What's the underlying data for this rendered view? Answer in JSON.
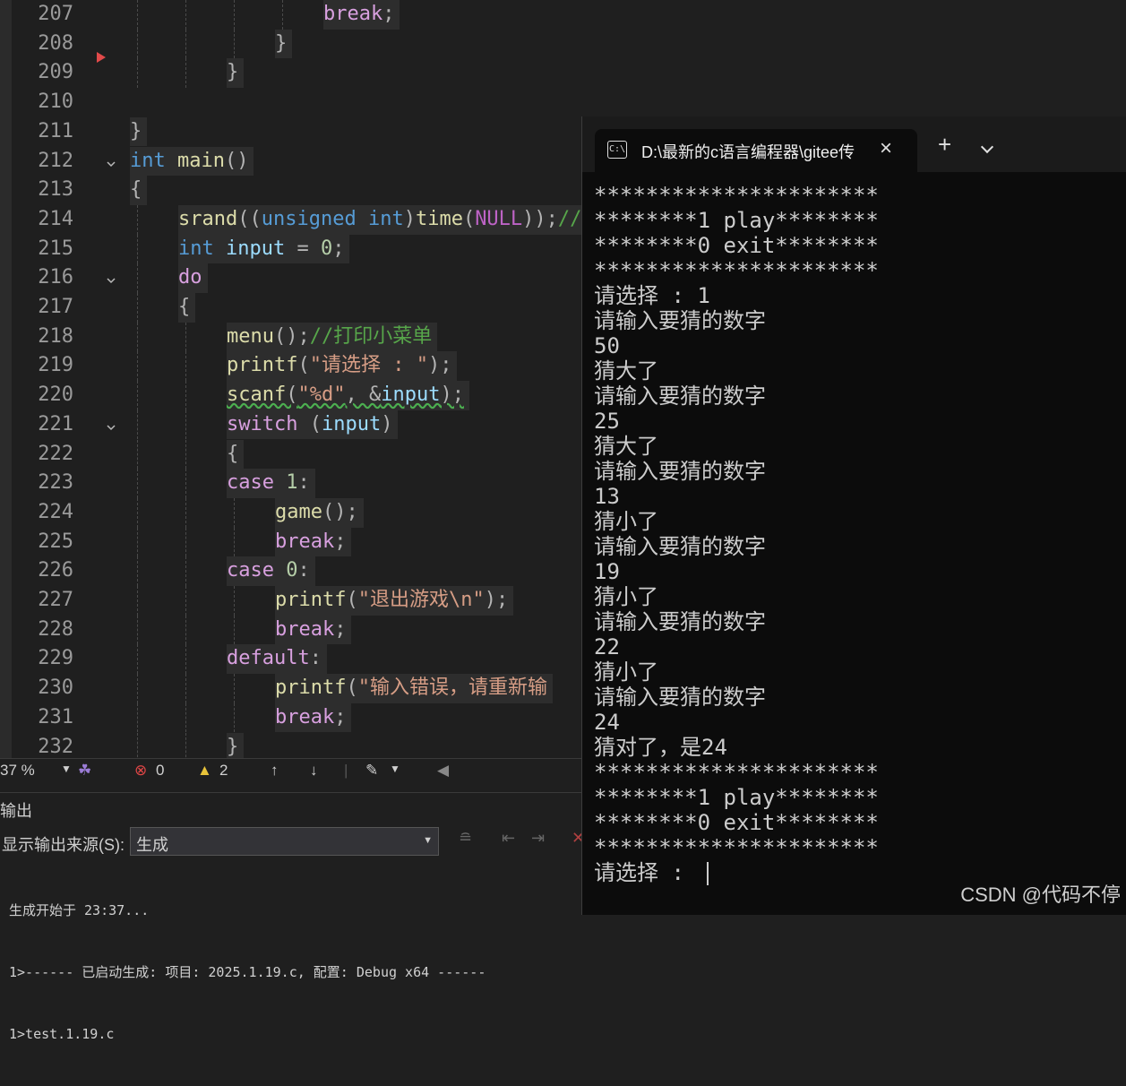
{
  "editor": {
    "lines": [
      {
        "n": "207",
        "indent": 4,
        "toks": [
          [
            "ctl",
            "break"
          ],
          [
            "pun",
            ";"
          ]
        ]
      },
      {
        "n": "208",
        "indent": 3,
        "toks": [
          [
            "pun",
            "}"
          ]
        ]
      },
      {
        "n": "209",
        "indent": 2,
        "toks": [
          [
            "pun",
            "}"
          ]
        ]
      },
      {
        "n": "210",
        "indent": 0,
        "toks": []
      },
      {
        "n": "211",
        "indent": 0,
        "toks": [
          [
            "pun",
            "}"
          ]
        ]
      },
      {
        "n": "212",
        "indent": 0,
        "fold": true,
        "toks": [
          [
            "kw",
            "int"
          ],
          [
            "pun",
            " "
          ],
          [
            "fn",
            "main"
          ],
          [
            "pun",
            "()"
          ]
        ]
      },
      {
        "n": "213",
        "indent": 0,
        "toks": [
          [
            "pun",
            "{"
          ]
        ]
      },
      {
        "n": "214",
        "indent": 1,
        "toks": [
          [
            "fn",
            "srand"
          ],
          [
            "pun",
            "(("
          ],
          [
            "kw",
            "unsigned"
          ],
          [
            "pun",
            " "
          ],
          [
            "kw",
            "int"
          ],
          [
            "pun",
            ")"
          ],
          [
            "fn",
            "time"
          ],
          [
            "pun",
            "("
          ],
          [
            "mac",
            "NULL"
          ],
          [
            "pun",
            "));"
          ],
          [
            "cmt",
            "//"
          ]
        ]
      },
      {
        "n": "215",
        "indent": 1,
        "toks": [
          [
            "kw",
            "int"
          ],
          [
            "pun",
            " "
          ],
          [
            "var",
            "input"
          ],
          [
            "pun",
            " = "
          ],
          [
            "num",
            "0"
          ],
          [
            "pun",
            ";"
          ]
        ]
      },
      {
        "n": "216",
        "indent": 1,
        "fold": true,
        "toks": [
          [
            "ctl",
            "do"
          ]
        ]
      },
      {
        "n": "217",
        "indent": 1,
        "toks": [
          [
            "pun",
            "{"
          ]
        ]
      },
      {
        "n": "218",
        "indent": 2,
        "toks": [
          [
            "fn",
            "menu"
          ],
          [
            "pun",
            "();"
          ],
          [
            "cmt",
            "//打印小菜单"
          ]
        ]
      },
      {
        "n": "219",
        "indent": 2,
        "toks": [
          [
            "fn",
            "printf"
          ],
          [
            "pun",
            "("
          ],
          [
            "str",
            "\"请选择 : \""
          ],
          [
            "pun",
            ");"
          ]
        ]
      },
      {
        "n": "220",
        "indent": 2,
        "squig": true,
        "toks": [
          [
            "fn",
            "scanf"
          ],
          [
            "pun",
            "("
          ],
          [
            "str",
            "\"%d\""
          ],
          [
            "pun",
            ", &"
          ],
          [
            "var",
            "input"
          ],
          [
            "pun",
            ");"
          ]
        ]
      },
      {
        "n": "221",
        "indent": 2,
        "fold": true,
        "toks": [
          [
            "ctl",
            "switch"
          ],
          [
            "pun",
            " ("
          ],
          [
            "var",
            "input"
          ],
          [
            "pun",
            ")"
          ]
        ]
      },
      {
        "n": "222",
        "indent": 2,
        "toks": [
          [
            "pun",
            "{"
          ]
        ]
      },
      {
        "n": "223",
        "indent": 2,
        "toks": [
          [
            "ctl",
            "case"
          ],
          [
            "pun",
            " "
          ],
          [
            "num",
            "1"
          ],
          [
            "pun",
            ":"
          ]
        ]
      },
      {
        "n": "224",
        "indent": 3,
        "toks": [
          [
            "fn",
            "game"
          ],
          [
            "pun",
            "();"
          ]
        ]
      },
      {
        "n": "225",
        "indent": 3,
        "toks": [
          [
            "ctl",
            "break"
          ],
          [
            "pun",
            ";"
          ]
        ]
      },
      {
        "n": "226",
        "indent": 2,
        "toks": [
          [
            "ctl",
            "case"
          ],
          [
            "pun",
            " "
          ],
          [
            "num",
            "0"
          ],
          [
            "pun",
            ":"
          ]
        ]
      },
      {
        "n": "227",
        "indent": 3,
        "toks": [
          [
            "fn",
            "printf"
          ],
          [
            "pun",
            "("
          ],
          [
            "str",
            "\"退出游戏\\n\""
          ],
          [
            "pun",
            ");"
          ]
        ]
      },
      {
        "n": "228",
        "indent": 3,
        "toks": [
          [
            "ctl",
            "break"
          ],
          [
            "pun",
            ";"
          ]
        ]
      },
      {
        "n": "229",
        "indent": 2,
        "toks": [
          [
            "ctl",
            "default"
          ],
          [
            "pun",
            ":"
          ]
        ]
      },
      {
        "n": "230",
        "indent": 3,
        "toks": [
          [
            "fn",
            "printf"
          ],
          [
            "pun",
            "("
          ],
          [
            "str",
            "\"输入错误，请重新输"
          ]
        ]
      },
      {
        "n": "231",
        "indent": 3,
        "toks": [
          [
            "ctl",
            "break"
          ],
          [
            "pun",
            ";"
          ]
        ]
      },
      {
        "n": "232",
        "indent": 2,
        "toks": [
          [
            "pun",
            "}"
          ]
        ]
      }
    ]
  },
  "status": {
    "zoom": "37 %",
    "errors": "0",
    "warnings": "2"
  },
  "output": {
    "title": "输出",
    "source_label": "显示输出来源(S):",
    "source_value": "生成",
    "log": [
      "生成开始于 23:37...",
      "1>------ 已启动生成: 项目: 2025.1.19.c, 配置: Debug x64 ------",
      "1>test.1.19.c"
    ]
  },
  "console": {
    "tab_title": "D:\\最新的c语言编程器\\gitee传",
    "lines": [
      "**********************",
      "********1 play********",
      "********0 exit********",
      "**********************",
      "请选择 : 1",
      "请输入要猜的数字",
      "50",
      "猜大了",
      "请输入要猜的数字",
      "25",
      "猜大了",
      "请输入要猜的数字",
      "13",
      "猜小了",
      "请输入要猜的数字",
      "19",
      "猜小了",
      "请输入要猜的数字",
      "22",
      "猜小了",
      "请输入要猜的数字",
      "24",
      "猜对了，是24",
      "**********************",
      "********1 play********",
      "********0 exit********",
      "**********************",
      "请选择 : "
    ]
  },
  "watermark": "CSDN @代码不停"
}
